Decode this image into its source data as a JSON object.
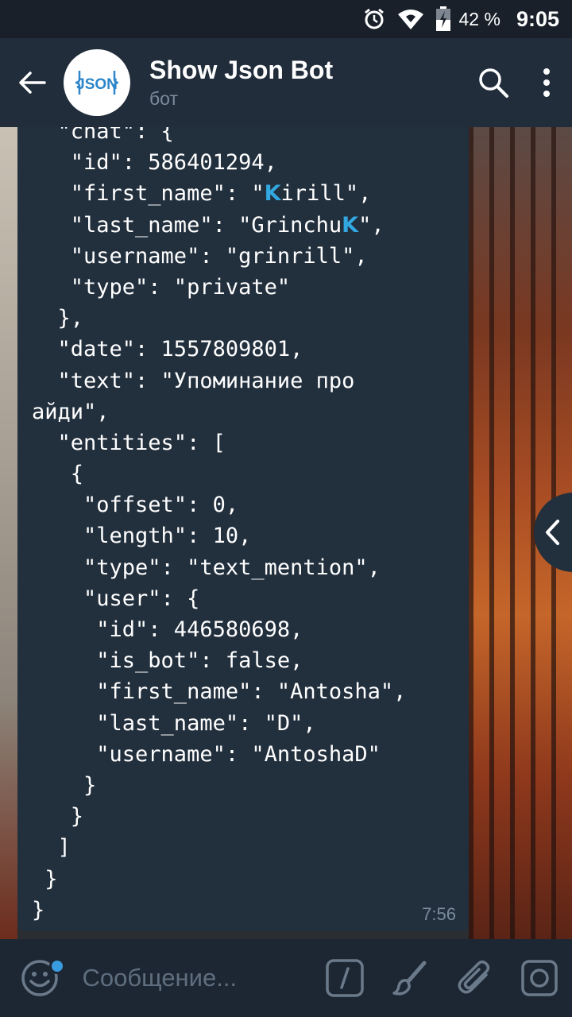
{
  "status_bar": {
    "battery_percent": "42 %",
    "time": "9:05",
    "icons": [
      "alarm-icon",
      "wifi-icon",
      "battery-icon"
    ]
  },
  "header": {
    "title": "Show Json Bot",
    "subtitle": "бот",
    "avatar_label": "JSON",
    "icons": [
      "back-arrow-icon",
      "search-icon",
      "more-vert-icon"
    ]
  },
  "message": {
    "time": "7:56",
    "json_lines": [
      "  \"chat\": {",
      "   \"id\": 586401294,",
      "   \"first_name\": \"[K]irill\",",
      "   \"last_name\": \"Grinchu[K]\",",
      "   \"username\": \"grinrill\",",
      "   \"type\": \"private\"",
      "  },",
      "  \"date\": 1557809801,",
      "  \"text\": \"Упоминание про",
      "айди\",",
      "  \"entities\": [",
      "   {",
      "    \"offset\": 0,",
      "    \"length\": 10,",
      "    \"type\": \"text_mention\",",
      "    \"user\": {",
      "     \"id\": 446580698,",
      "     \"is_bot\": false,",
      "     \"first_name\": \"Antosha\",",
      "     \"last_name\": \"D\",",
      "     \"username\": \"AntoshaD\"",
      "    }",
      "   }",
      "  ]",
      " }",
      "}"
    ],
    "emoji_letter": "K"
  },
  "input": {
    "placeholder": "Сообщение...",
    "value": ""
  },
  "colors": {
    "header_bg": "#212d3b",
    "bubble_bg": "#222f3d",
    "accent": "#3a9ce0",
    "muted_text": "#7b8b9b"
  }
}
